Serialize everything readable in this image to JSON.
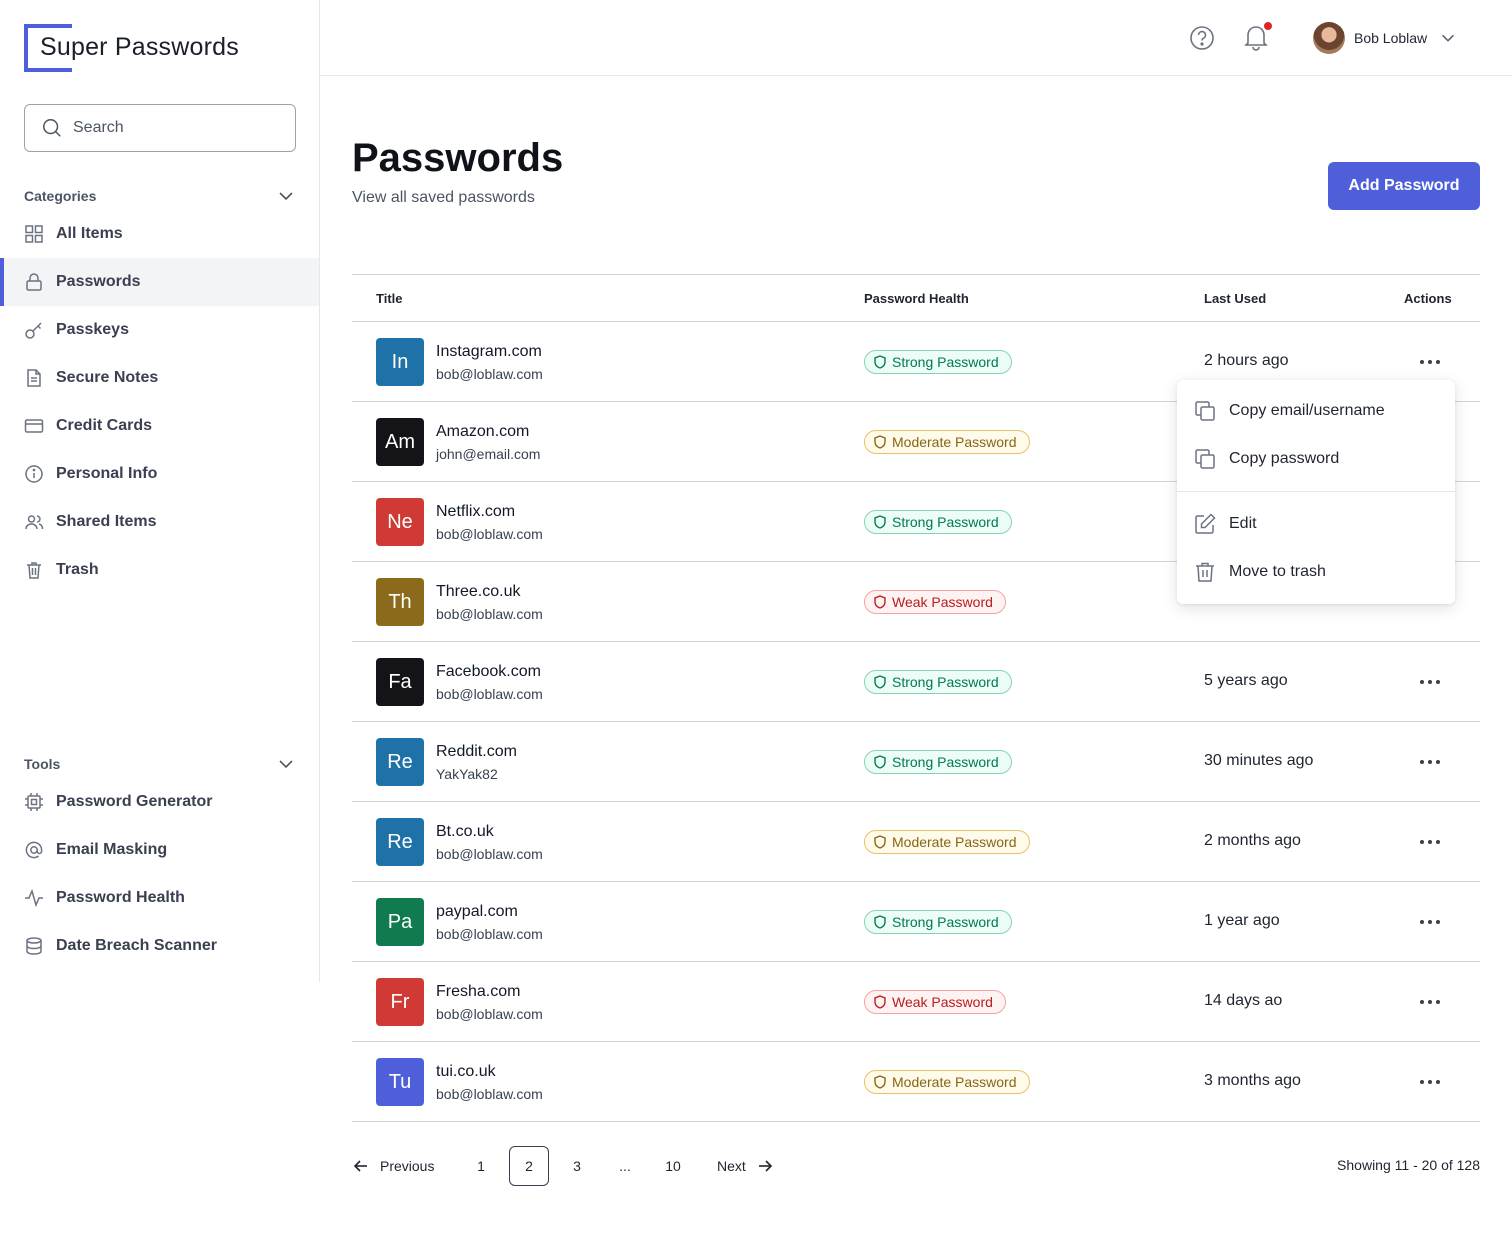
{
  "app": {
    "name": "Super Passwords"
  },
  "search": {
    "placeholder": "Search"
  },
  "categories": {
    "heading": "Categories",
    "items": [
      {
        "label": "All Items",
        "icon": "grid-icon"
      },
      {
        "label": "Passwords",
        "icon": "lock-icon",
        "active": true
      },
      {
        "label": "Passkeys",
        "icon": "key-icon"
      },
      {
        "label": "Secure Notes",
        "icon": "document-icon"
      },
      {
        "label": "Credit Cards",
        "icon": "credit-card-icon"
      },
      {
        "label": "Personal Info",
        "icon": "info-icon"
      },
      {
        "label": "Shared Items",
        "icon": "users-icon"
      },
      {
        "label": "Trash",
        "icon": "trash-icon"
      }
    ]
  },
  "tools": {
    "heading": "Tools",
    "items": [
      {
        "label": "Password Generator",
        "icon": "chip-icon"
      },
      {
        "label": "Email Masking",
        "icon": "at-icon"
      },
      {
        "label": "Password Health",
        "icon": "pulse-icon"
      },
      {
        "label": "Date Breach Scanner",
        "icon": "database-icon"
      }
    ]
  },
  "header": {
    "user_name": "Bob Loblaw",
    "notification_dot_color": "#dc2626"
  },
  "page": {
    "title": "Passwords",
    "subtitle": "View all saved passwords",
    "add_button": "Add Password"
  },
  "table": {
    "columns": [
      "Title",
      "Password Health",
      "Last Used",
      "Actions"
    ],
    "rows": [
      {
        "initials": "In",
        "color": "#1f72a8",
        "site": "Instagram.com",
        "account": "bob@loblaw.com",
        "health": "Strong Password",
        "level": "strong",
        "last_used": "2 hours ago"
      },
      {
        "initials": "Am",
        "color": "#141418",
        "site": "Amazon.com",
        "account": "john@email.com",
        "health": "Moderate Password",
        "level": "moderate",
        "last_used": ""
      },
      {
        "initials": "Ne",
        "color": "#cf3a35",
        "site": "Netflix.com",
        "account": "bob@loblaw.com",
        "health": "Strong Password",
        "level": "strong",
        "last_used": ""
      },
      {
        "initials": "Th",
        "color": "#8c6a1c",
        "site": "Three.co.uk",
        "account": "bob@loblaw.com",
        "health": "Weak Password",
        "level": "weak",
        "last_used": ""
      },
      {
        "initials": "Fa",
        "color": "#141418",
        "site": "Facebook.com",
        "account": "bob@loblaw.com",
        "health": "Strong Password",
        "level": "strong",
        "last_used": "5 years ago"
      },
      {
        "initials": "Re",
        "color": "#1f72a8",
        "site": "Reddit.com",
        "account": "YakYak82",
        "health": "Strong Password",
        "level": "strong",
        "last_used": "30 minutes ago"
      },
      {
        "initials": "Re",
        "color": "#1f72a8",
        "site": "Bt.co.uk",
        "account": "bob@loblaw.com",
        "health": "Moderate Password",
        "level": "moderate",
        "last_used": "2 months ago"
      },
      {
        "initials": "Pa",
        "color": "#0f7b4f",
        "site": "paypal.com",
        "account": "bob@loblaw.com",
        "health": "Strong Password",
        "level": "strong",
        "last_used": "1 year ago"
      },
      {
        "initials": "Fr",
        "color": "#cf3a35",
        "site": "Fresha.com",
        "account": "bob@loblaw.com",
        "health": "Weak Password",
        "level": "weak",
        "last_used": "14 days ao"
      },
      {
        "initials": "Tu",
        "color": "#4f5fd9",
        "site": "tui.co.uk",
        "account": "bob@loblaw.com",
        "health": "Moderate Password",
        "level": "moderate",
        "last_used": "3 months ago"
      }
    ]
  },
  "actions_menu": {
    "items": [
      {
        "label": "Copy email/username",
        "icon": "copy-icon"
      },
      {
        "label": "Copy password",
        "icon": "copy-icon"
      },
      {
        "label": "Edit",
        "icon": "edit-icon"
      },
      {
        "label": "Move to trash",
        "icon": "trash-icon"
      }
    ]
  },
  "pagination": {
    "previous": "Previous",
    "next": "Next",
    "pages": [
      "1",
      "2",
      "3",
      "...",
      "10"
    ],
    "current": "2",
    "showing": "Showing 11 - 20 of 128"
  },
  "colors": {
    "accent": "#4f5fd9"
  }
}
